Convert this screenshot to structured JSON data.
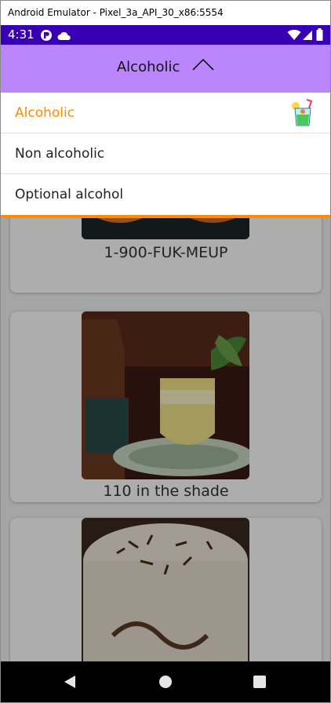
{
  "window": {
    "title": "Android Emulator - Pixel_3a_API_30_x86:5554"
  },
  "status_bar": {
    "time": "4:31"
  },
  "app_bar": {
    "title": "Alcoholic"
  },
  "dropdown": {
    "items": [
      {
        "label": "Alcoholic",
        "selected": true
      },
      {
        "label": "Non alcoholic",
        "selected": false
      },
      {
        "label": "Optional alcohol",
        "selected": false
      }
    ]
  },
  "drinks": [
    {
      "name": "1-900-FUK-MEUP"
    },
    {
      "name": "110 in the shade"
    },
    {
      "name": ""
    }
  ],
  "colors": {
    "status_bar": "#3700b3",
    "app_bar": "#bb86fc",
    "accent": "#ff8c00"
  }
}
